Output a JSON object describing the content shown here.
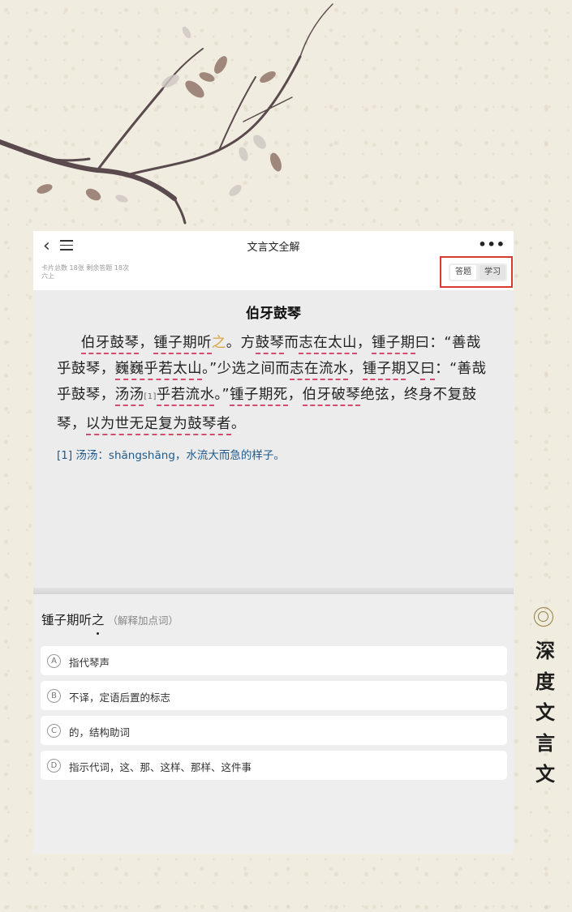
{
  "app": {
    "title": "文言文全解",
    "back_icon": "chevron-left-icon",
    "menu_icon": "menu-icon",
    "more_icon": "more-icon",
    "more_label": "•••"
  },
  "stats": {
    "line1": "卡片总数 18张  剩余答题 18次",
    "line2": "六上"
  },
  "mode_toggle": {
    "answer_label": "答题",
    "study_label": "学习",
    "highlight_color": "#d93a2f"
  },
  "passage": {
    "title": "伯牙鼓琴",
    "segments": [
      {
        "text": "伯牙鼓琴",
        "u": true
      },
      {
        "text": "，",
        "u": false
      },
      {
        "text": "锺子期听",
        "u": true
      },
      {
        "text": "之",
        "key": true
      },
      {
        "text": "。方",
        "u": false
      },
      {
        "text": "鼓琴",
        "u": true
      },
      {
        "text": "而",
        "u": false
      },
      {
        "text": "志在太山",
        "u": true
      },
      {
        "text": "，",
        "u": false
      },
      {
        "text": "锺子期",
        "u": true
      },
      {
        "text": "曰：“",
        "u": false
      },
      {
        "text": "善哉乎鼓琴",
        "u": true
      },
      {
        "text": "，",
        "u": false
      },
      {
        "text": "巍巍乎若太山",
        "u": true
      },
      {
        "text": "。”少选之间而",
        "u": false
      },
      {
        "text": "志在流水",
        "u": true
      },
      {
        "text": "，",
        "u": false
      },
      {
        "text": "锺子期",
        "u": true
      },
      {
        "text": "又",
        "u": false
      },
      {
        "text": "曰",
        "u": true
      },
      {
        "text": "：“",
        "u": false
      },
      {
        "text": "善哉乎鼓琴",
        "u": true
      },
      {
        "text": "，",
        "u": false
      },
      {
        "text": "汤汤",
        "u": true
      },
      {
        "text": "[1]",
        "sup": true
      },
      {
        "text": "乎若流水",
        "u": true
      },
      {
        "text": "。”",
        "u": false
      },
      {
        "text": "锺子期死",
        "u": true
      },
      {
        "text": "，",
        "u": false
      },
      {
        "text": "伯牙破琴",
        "u": true
      },
      {
        "text": "绝弦",
        "u": false
      },
      {
        "text": "，",
        "u": false
      },
      {
        "text": "终身不复鼓琴",
        "u": true
      },
      {
        "text": "，",
        "u": false
      },
      {
        "text": "以为世无足复为鼓琴者",
        "u": true
      },
      {
        "text": "。",
        "u": false
      }
    ],
    "footnote": "[1] 汤汤：shāngshāng，水流大而急的样子。",
    "underline_color": "#d34b6f",
    "keyword_color": "#d9a441"
  },
  "question": {
    "prefix": "锺子期听",
    "keyword": "之",
    "hint": "（解释加点词）",
    "options": [
      {
        "letter": "A",
        "text": "指代琴声"
      },
      {
        "letter": "B",
        "text": "不译，定语后置的标志"
      },
      {
        "letter": "C",
        "text": "的，结构助词"
      },
      {
        "letter": "D",
        "text": "指示代词，这、那、这样、那样、这件事"
      }
    ]
  },
  "side_title": {
    "chars": [
      "深",
      "度",
      "文",
      "言",
      "文"
    ]
  }
}
